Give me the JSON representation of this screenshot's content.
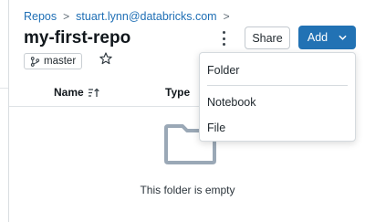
{
  "breadcrumb": {
    "items": [
      "Repos",
      "stuart.lynn@databricks.com"
    ],
    "separator": ">"
  },
  "repo": {
    "title": "my-first-repo",
    "branch": "master"
  },
  "header_actions": {
    "share_label": "Share",
    "add_label": "Add"
  },
  "table": {
    "columns": [
      "Name",
      "Type"
    ]
  },
  "empty_state": {
    "text": "This folder is empty"
  },
  "add_menu": {
    "items": [
      "Folder",
      "Notebook",
      "File"
    ]
  },
  "colors": {
    "accent": "#2272b4",
    "link": "#1f6fb5",
    "folder_icon": "#9aa8b6"
  },
  "icons": {
    "branch": "git-branch-icon",
    "star": "star-icon",
    "kebab": "kebab-menu-icon",
    "add_caret": "chevron-down-icon",
    "sort": "sort-ascending-icon",
    "empty": "folder-icon"
  }
}
